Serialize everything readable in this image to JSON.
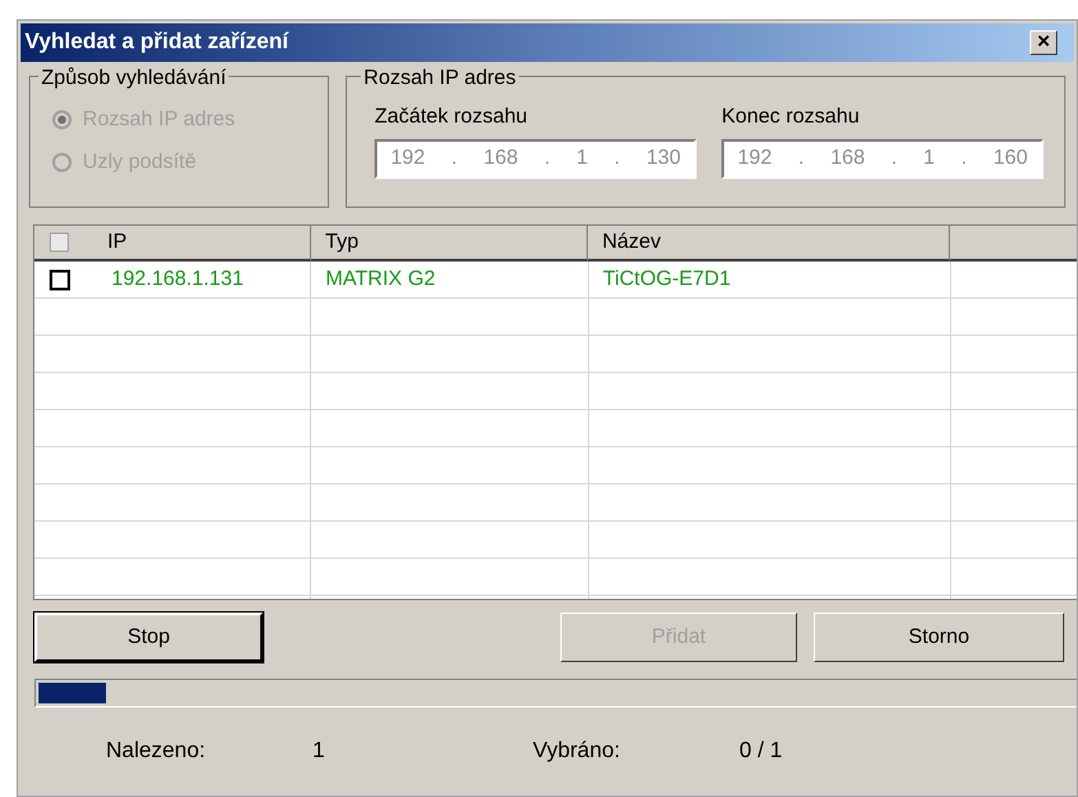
{
  "window": {
    "title": "Vyhledat a přidat zařízení",
    "close": "×"
  },
  "search_method": {
    "title": "Způsob vyhledávání",
    "options": [
      {
        "label": "Rozsah IP adres",
        "selected": true,
        "disabled": true
      },
      {
        "label": "Uzly podsítě",
        "selected": false,
        "disabled": true
      }
    ]
  },
  "ip_range": {
    "title": "Rozsah IP adres",
    "fields": [
      {
        "label": "Začátek rozsahu",
        "octets": [
          "192",
          "168",
          "1",
          "130"
        ],
        "separators": [
          ".",
          ".",
          "."
        ]
      },
      {
        "label": "Konec rozsahu",
        "octets": [
          "192",
          "168",
          "1",
          "160"
        ],
        "separators": [
          ".",
          ".",
          "."
        ]
      }
    ]
  },
  "table": {
    "header_checked": false,
    "columns": [
      "IP",
      "Typ",
      "Název"
    ],
    "rows": [
      {
        "checked": false,
        "cells": [
          "192.168.1.131",
          "MATRIX G2",
          "TiCtOG-E7D1"
        ]
      }
    ]
  },
  "buttons": [
    {
      "label": "Stop",
      "disabled": false
    },
    {
      "label": "Přidat",
      "disabled": true
    },
    {
      "label": "Storno",
      "disabled": false
    }
  ],
  "progress": {
    "level": 0.065
  },
  "status": [
    {
      "label": "Nalezeno:",
      "value": "1"
    },
    {
      "label": "Vybráno:",
      "value": "0 / 1"
    }
  ]
}
